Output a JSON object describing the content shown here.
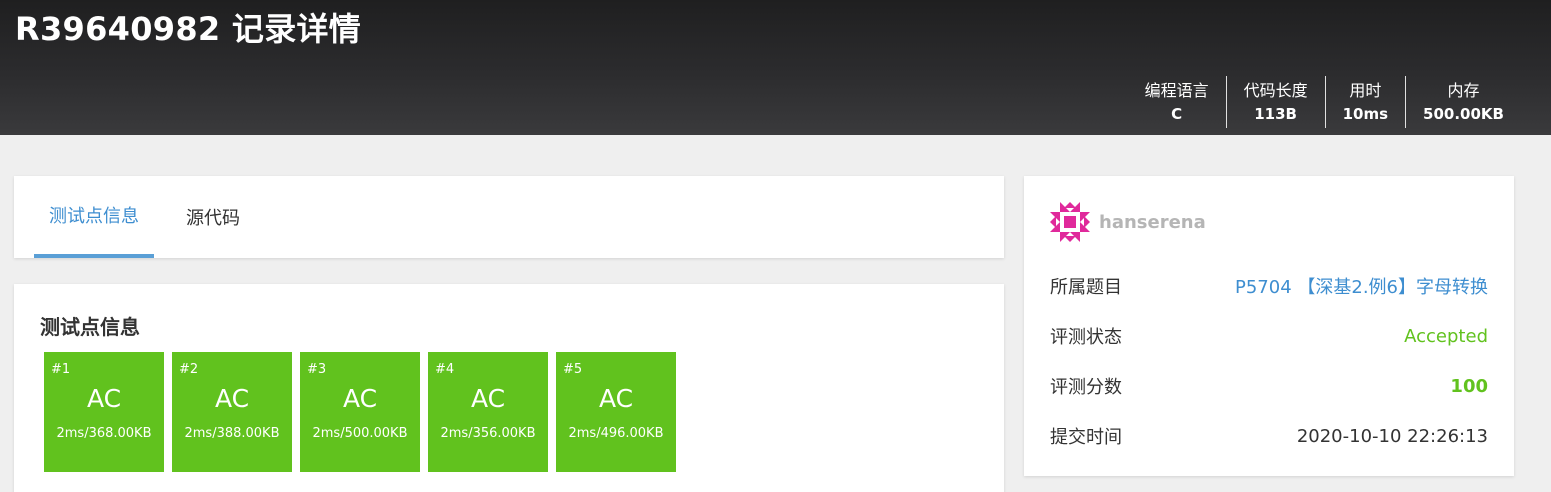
{
  "header": {
    "title": "R39640982 记录详情",
    "stats": [
      {
        "label": "编程语言",
        "value": "C"
      },
      {
        "label": "代码长度",
        "value": "113B"
      },
      {
        "label": "用时",
        "value": "10ms"
      },
      {
        "label": "内存",
        "value": "500.00KB"
      }
    ]
  },
  "tabs": [
    {
      "label": "测试点信息",
      "active": true
    },
    {
      "label": "源代码",
      "active": false
    }
  ],
  "testcases": {
    "title": "测试点信息",
    "items": [
      {
        "id": "#1",
        "status": "AC",
        "detail": "2ms/368.00KB"
      },
      {
        "id": "#2",
        "status": "AC",
        "detail": "2ms/388.00KB"
      },
      {
        "id": "#3",
        "status": "AC",
        "detail": "2ms/500.00KB"
      },
      {
        "id": "#4",
        "status": "AC",
        "detail": "2ms/356.00KB"
      },
      {
        "id": "#5",
        "status": "AC",
        "detail": "2ms/496.00KB"
      }
    ]
  },
  "info": {
    "username": "hanserena",
    "avatar_icon": "identicon-avatar",
    "problem_label": "所属题目",
    "problem_value": "P5704 【深基2.例6】字母转换",
    "status_label": "评测状态",
    "status_value": "Accepted",
    "score_label": "评测分数",
    "score_value": "100",
    "time_label": "提交时间",
    "time_value": "2020-10-10 22:26:13"
  },
  "colors": {
    "accepted": "#61c21e",
    "link": "#3e8ed0",
    "avatar": "#e0299b",
    "header_bg": "#2c2c2e"
  }
}
